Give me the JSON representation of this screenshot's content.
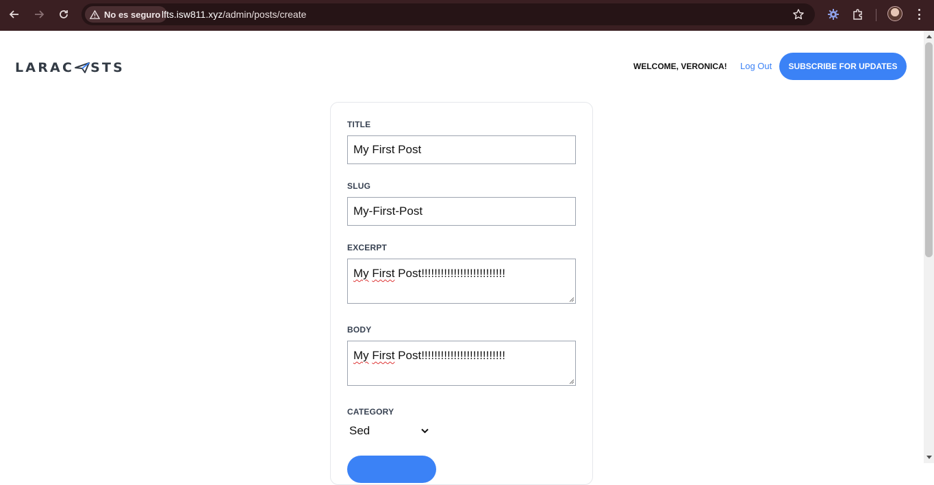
{
  "browser": {
    "security_label": "No es seguro",
    "url_host": "lfts.isw811.xyz",
    "url_path": "/admin/posts/create"
  },
  "header": {
    "logo_left": "LARAC",
    "logo_right": "STS",
    "welcome": "WELCOME, VERONICA!",
    "logout": "Log Out",
    "subscribe": "SUBSCRIBE FOR UPDATES"
  },
  "form": {
    "title_label": "TITLE",
    "title_value": "My First Post",
    "slug_label": "SLUG",
    "slug_value": "My-First-Post",
    "excerpt_label": "EXCERPT",
    "excerpt_word1": "My",
    "excerpt_word2": "First",
    "excerpt_rest": " Post!!!!!!!!!!!!!!!!!!!!!!!!!!",
    "body_label": "BODY",
    "body_word1": "My",
    "body_word2": "First",
    "body_rest": " Post!!!!!!!!!!!!!!!!!!!!!!!!!!",
    "category_label": "CATEGORY",
    "category_value": "Sed"
  },
  "colors": {
    "accent": "#3b82f6",
    "chrome": "#3a1f22"
  }
}
